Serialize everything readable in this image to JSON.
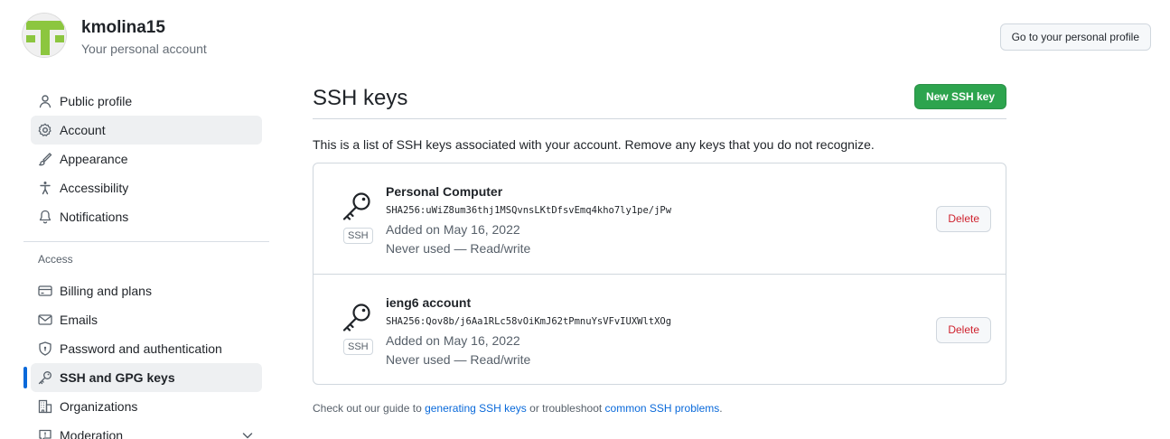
{
  "header": {
    "username": "kmolina15",
    "subtitle": "Your personal account",
    "profile_button": "Go to your personal profile",
    "avatar_color": "#8cc63f"
  },
  "sidebar": {
    "items_top": [
      {
        "label": "Public profile",
        "icon": "person-icon"
      },
      {
        "label": "Account",
        "icon": "gear-icon"
      },
      {
        "label": "Appearance",
        "icon": "paintbrush-icon"
      },
      {
        "label": "Accessibility",
        "icon": "accessibility-icon"
      },
      {
        "label": "Notifications",
        "icon": "bell-icon"
      }
    ],
    "access_heading": "Access",
    "items_access": [
      {
        "label": "Billing and plans",
        "icon": "credit-card-icon"
      },
      {
        "label": "Emails",
        "icon": "mail-icon"
      },
      {
        "label": "Password and authentication",
        "icon": "shield-lock-icon"
      },
      {
        "label": "SSH and GPG keys",
        "icon": "key-icon"
      },
      {
        "label": "Organizations",
        "icon": "organization-icon"
      },
      {
        "label": "Moderation",
        "icon": "report-icon"
      }
    ]
  },
  "main": {
    "title": "SSH keys",
    "new_key_button": "New SSH key",
    "description": "This is a list of SSH keys associated with your account. Remove any keys that you do not recognize.",
    "keys": [
      {
        "title": "Personal Computer",
        "badge": "SSH",
        "fingerprint": "SHA256:uWiZ8um36thj1MSQvnsLKtDfsvEmq4kho7ly1pe/jPw",
        "added": "Added on May 16, 2022",
        "usage": "Never used — Read/write",
        "delete_label": "Delete"
      },
      {
        "title": "ieng6 account",
        "badge": "SSH",
        "fingerprint": "SHA256:Qov8b/j6Aa1RLc58vOiKmJ62tPmnuYsVFvIUXWltXOg",
        "added": "Added on May 16, 2022",
        "usage": "Never used — Read/write",
        "delete_label": "Delete"
      }
    ],
    "footer": {
      "prefix": "Check out our guide to ",
      "link1": "generating SSH keys",
      "middle": " or troubleshoot ",
      "link2": "common SSH problems",
      "suffix": "."
    }
  },
  "colors": {
    "accent": "#0969da",
    "primary_button": "#2da44e",
    "danger": "#cf222e"
  }
}
